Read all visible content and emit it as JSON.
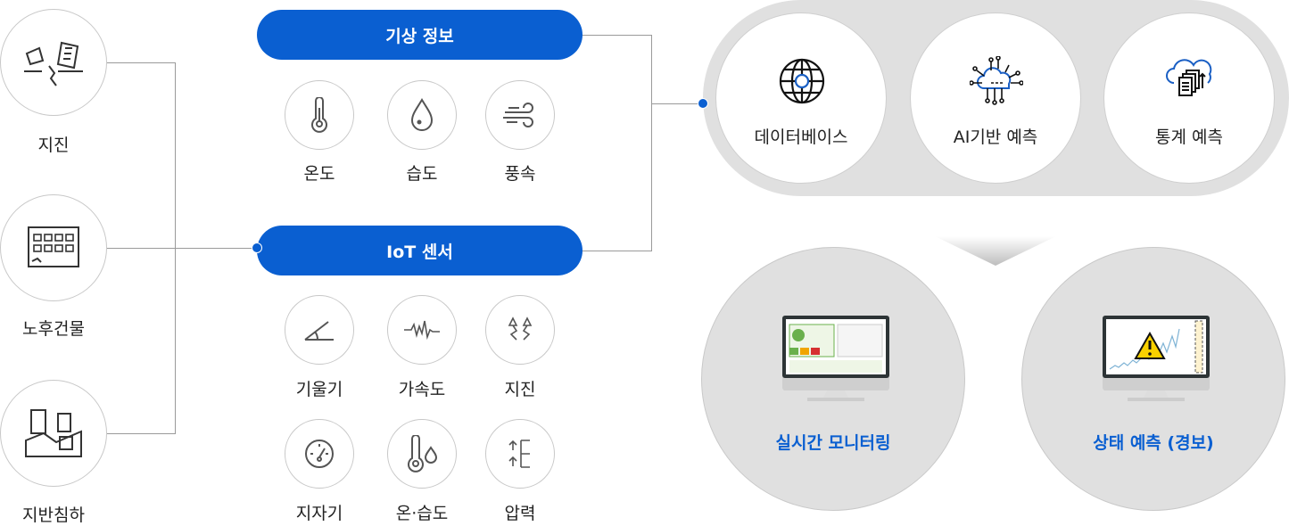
{
  "hazards": [
    {
      "label": "지진",
      "icon": "earthquake-icon"
    },
    {
      "label": "노후건물",
      "icon": "old-building-icon"
    },
    {
      "label": "지반침하",
      "icon": "ground-subsidence-icon"
    }
  ],
  "weather": {
    "title": "기상 정보",
    "items": [
      {
        "label": "온도",
        "icon": "thermometer-icon"
      },
      {
        "label": "습도",
        "icon": "droplet-icon"
      },
      {
        "label": "풍속",
        "icon": "wind-icon"
      }
    ]
  },
  "iot": {
    "title": "IoT 센서",
    "items": [
      {
        "label": "기울기",
        "icon": "tilt-angle-icon"
      },
      {
        "label": "가속도",
        "icon": "waveform-icon"
      },
      {
        "label": "지진",
        "icon": "seismic-icon"
      },
      {
        "label": "지자기",
        "icon": "gauge-icon"
      },
      {
        "label": "온·습도",
        "icon": "thermo-humidity-icon"
      },
      {
        "label": "압력",
        "icon": "pressure-icon"
      }
    ]
  },
  "analysis": [
    {
      "label": "데이터베이스",
      "icon": "globe-database-icon"
    },
    {
      "label": "AI기반 예측",
      "icon": "ai-cloud-icon"
    },
    {
      "label": "통계 예측",
      "icon": "cloud-documents-icon"
    }
  ],
  "outputs": [
    {
      "label": "실시간 모니터링",
      "icon": "monitor-dashboard-icon"
    },
    {
      "label": "상태 예측 (경보)",
      "icon": "monitor-warning-icon"
    }
  ],
  "colors": {
    "accent": "#0a5fd1",
    "capsule": "#e0e0e0"
  }
}
